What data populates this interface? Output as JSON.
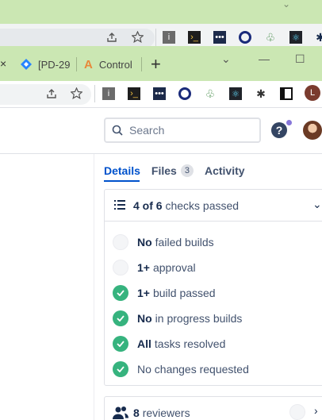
{
  "browser": {
    "tabs": [
      {
        "label": "[PD-29"
      },
      {
        "label": "Control"
      }
    ],
    "new_tab_label": "+",
    "close_glyph": "×",
    "window_controls": [
      "⌄",
      "—",
      "☐"
    ]
  },
  "header": {
    "search_placeholder": "Search",
    "help_label": "?"
  },
  "panel": {
    "tabs": [
      {
        "label": "Details",
        "active": true
      },
      {
        "label": "Files",
        "count": "3"
      },
      {
        "label": "Activity"
      }
    ],
    "checks": {
      "summary_bold": "4 of 6",
      "summary_rest": "checks passed",
      "items": [
        {
          "bold": "No",
          "text": "failed builds",
          "status": "pending"
        },
        {
          "bold": "1+",
          "text": "approval",
          "status": "pending"
        },
        {
          "bold": "1+",
          "text": "build passed",
          "status": "passed"
        },
        {
          "bold": "No",
          "text": "in progress builds",
          "status": "passed"
        },
        {
          "bold": "All",
          "text": "tasks resolved",
          "status": "passed"
        },
        {
          "bold": "",
          "text": "No changes requested",
          "status": "passed"
        }
      ]
    },
    "reviewers": {
      "count": "8",
      "label": "reviewers"
    }
  },
  "colors": {
    "accent": "#0052cc",
    "success": "#36b37e",
    "tabstrip": "#cbe7b3"
  },
  "icons": [
    "share-icon",
    "star-icon",
    "extension-icon",
    "search-icon",
    "help-icon",
    "list-icon",
    "check-icon",
    "people-icon",
    "chevron-down-icon",
    "chevron-right-icon"
  ]
}
